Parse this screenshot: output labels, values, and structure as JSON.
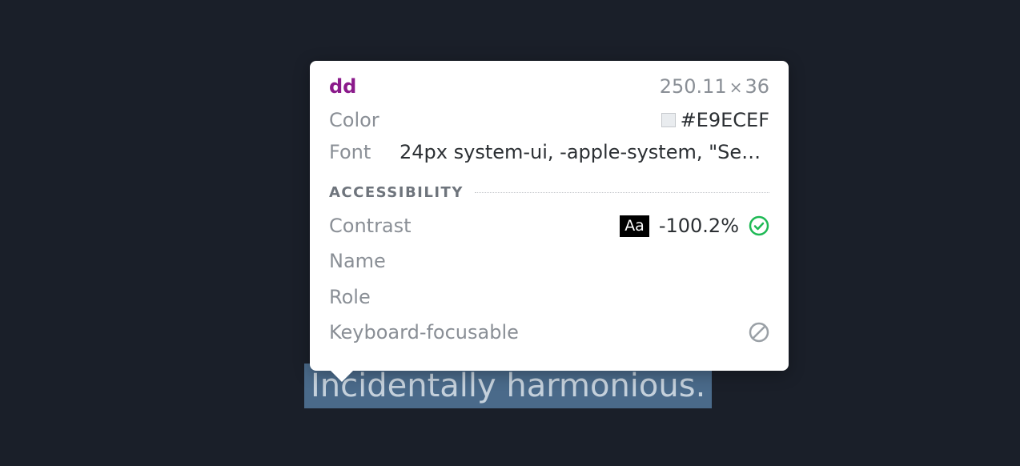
{
  "highlighted_text": "Incidentally harmonious.",
  "tooltip": {
    "element_tag": "dd",
    "dimensions_w": "250.11",
    "dimensions_h": "36",
    "color_label": "Color",
    "color_value": "#E9ECEF",
    "font_label": "Font",
    "font_value": "24px system-ui, -apple-system, \"Segoe…",
    "accessibility_header": "ACCESSIBILITY",
    "contrast_label": "Contrast",
    "contrast_badge": "Aa",
    "contrast_value": "-100.2%",
    "name_label": "Name",
    "role_label": "Role",
    "keyboard_label": "Keyboard-focusable"
  }
}
